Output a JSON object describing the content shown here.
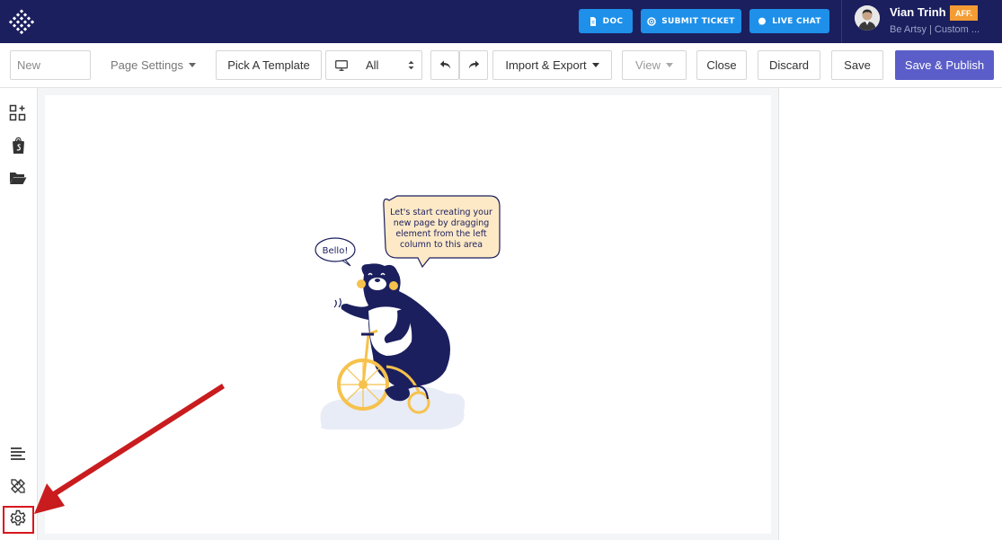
{
  "topbar": {
    "doc_label": "DOC",
    "ticket_label": "SUBMIT TICKET",
    "chat_label": "LIVE CHAT",
    "user_name": "Vian Trinh",
    "user_badge": "AFF.",
    "user_subtitle": "Be Artsy | Custom ..."
  },
  "toolbar": {
    "page_name_placeholder": "New",
    "page_settings_label": "Page Settings",
    "pick_template_label": "Pick A Template",
    "device_value": "All",
    "import_export_label": "Import & Export",
    "view_label": "View",
    "close_label": "Close",
    "discard_label": "Discard",
    "save_label": "Save",
    "save_publish_label": "Save & Publish"
  },
  "canvas": {
    "speech_small": "Bello!",
    "speech_large": [
      "Let's start creating your",
      "new page by dragging",
      "element from the left",
      "column to this area"
    ]
  },
  "sidebar": {
    "items": [
      {
        "icon": "add-element-icon"
      },
      {
        "icon": "shopify-icon"
      },
      {
        "icon": "folder-open-icon"
      },
      {
        "icon": "align-left-icon"
      },
      {
        "icon": "pen-ruler-icon"
      },
      {
        "icon": "gear-icon"
      }
    ]
  },
  "colors": {
    "navbar": "#1b1f5e",
    "topbar_button": "#1e90ea",
    "primary": "#5b5ec9",
    "badge": "#f39c34",
    "highlight": "#d9161e"
  }
}
